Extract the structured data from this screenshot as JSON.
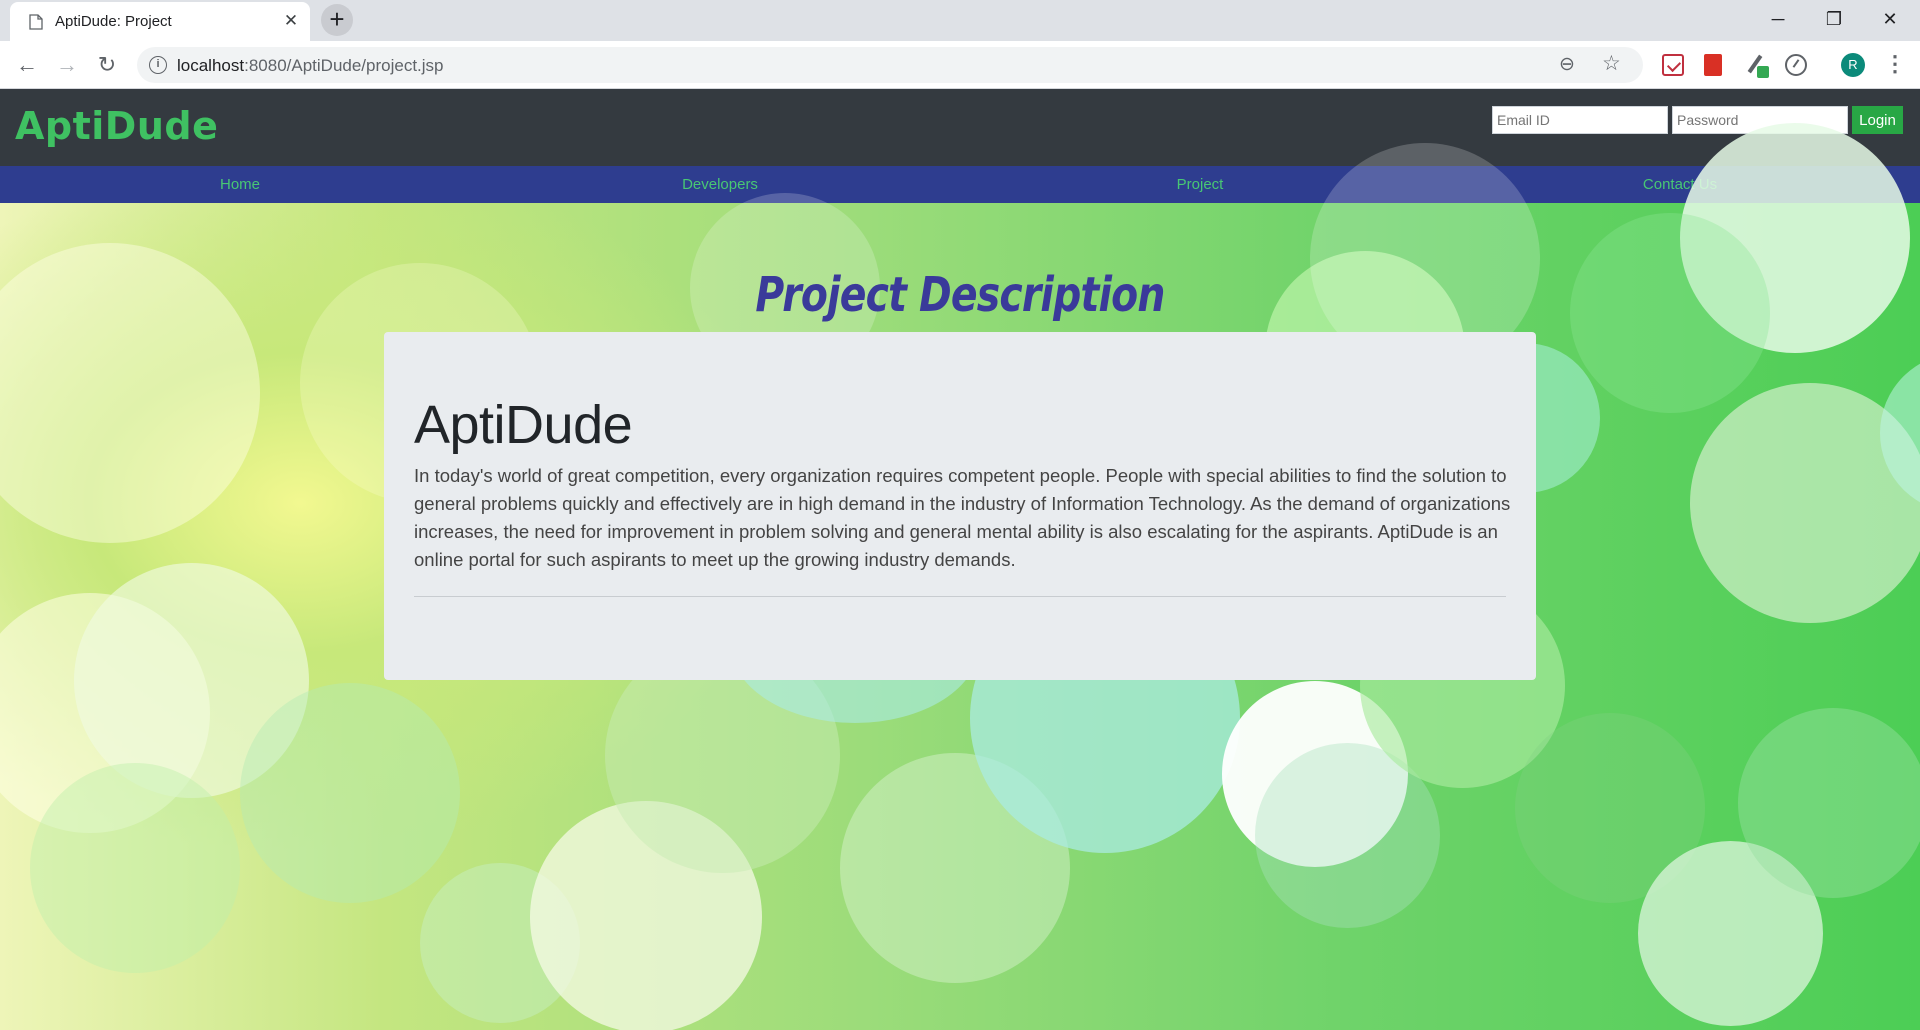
{
  "browser": {
    "tab_title": "AptiDude: Project",
    "tab_close": "✕",
    "new_tab": "+",
    "url_host": "localhost",
    "url_rest": ":8080/AptiDude/project.jsp",
    "window_minimize": "─",
    "window_restore": "❐",
    "window_close": "✕",
    "avatar_letter": "R"
  },
  "site": {
    "brand": "AptiDude",
    "email_placeholder": "Email ID",
    "password_placeholder": "Password",
    "login_label": "Login",
    "nav": [
      "Home",
      "Developers",
      "Project",
      "Contact Us"
    ],
    "colors": {
      "header": "#343a40",
      "nav": "#2e3d8f",
      "accent": "#3fc162"
    }
  },
  "content": {
    "section_title": "Project Description",
    "card_title": "AptiDude",
    "card_text": "In today's world of great competition, every organization requires competent people. People with special abilities to find the solution to general problems quickly and effectively are in high demand in the industry of Information Technology. As the demand of organizations increases, the need for improvement in problem solving and general mental ability is also escalating for the aspirants. AptiDude is an online portal for such aspirants to meet up the growing industry demands."
  }
}
